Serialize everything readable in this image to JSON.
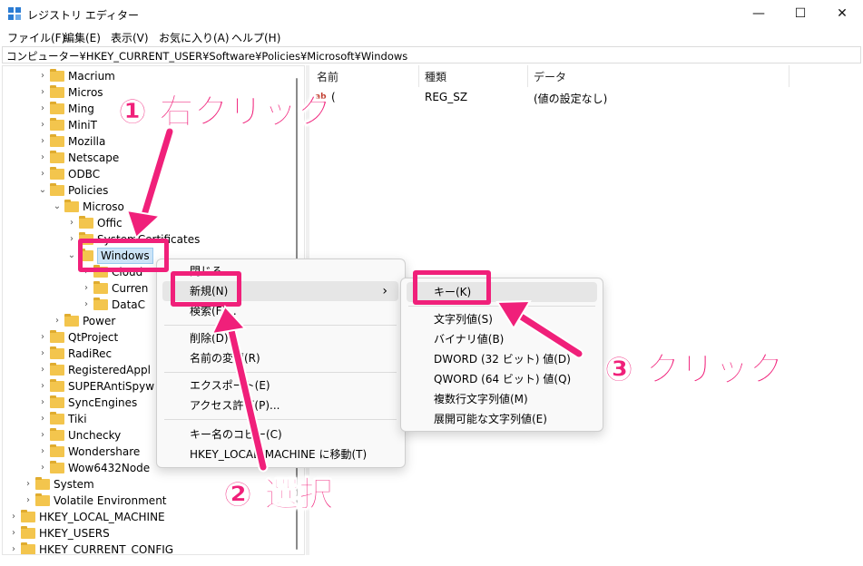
{
  "window": {
    "title": "レジストリ エディター",
    "minimize": "—",
    "maximize": "☐",
    "close": "✕"
  },
  "menu": [
    "ファイル(F)",
    "編集(E)",
    "表示(V)",
    "お気に入り(A)",
    "ヘルプ(H)"
  ],
  "address": "コンピューター¥HKEY_CURRENT_USER¥Software¥Policies¥Microsoft¥Windows",
  "tree": [
    {
      "label": "Macrium",
      "expanded": false
    },
    {
      "label": "Micros",
      "expanded": false
    },
    {
      "label": "Ming",
      "expanded": false
    },
    {
      "label": "MiniT",
      "expanded": false
    },
    {
      "label": "Mozilla",
      "expanded": false
    },
    {
      "label": "Netscape",
      "expanded": false
    },
    {
      "label": "ODBC",
      "expanded": false
    },
    {
      "label": "Policies",
      "expanded": true
    },
    {
      "label": "Microso",
      "expanded": true
    },
    {
      "label": "Offic",
      "expanded": false
    },
    {
      "label": "SystemCertificates",
      "expanded": false
    },
    {
      "label": "Windows",
      "expanded": true,
      "selected": true
    },
    {
      "label": "Cloud",
      "expanded": false
    },
    {
      "label": "Curren",
      "expanded": false
    },
    {
      "label": "DataC",
      "expanded": false
    },
    {
      "label": "Power",
      "expanded": false
    },
    {
      "label": "QtProject",
      "expanded": false
    },
    {
      "label": "RadiRec",
      "expanded": false
    },
    {
      "label": "RegisteredAppl",
      "expanded": false
    },
    {
      "label": "SUPERAntiSpyw",
      "expanded": false
    },
    {
      "label": "SyncEngines",
      "expanded": false
    },
    {
      "label": "Tiki",
      "expanded": false
    },
    {
      "label": "Unchecky",
      "expanded": false
    },
    {
      "label": "Wondershare",
      "expanded": false
    },
    {
      "label": "Wow6432Node",
      "expanded": false
    },
    {
      "label": "System",
      "expanded": false
    },
    {
      "label": "Volatile Environment",
      "expanded": false
    },
    {
      "label": "HKEY_LOCAL_MACHINE",
      "expanded": false
    },
    {
      "label": "HKEY_USERS",
      "expanded": false
    },
    {
      "label": "HKEY_CURRENT_CONFIG",
      "expanded": false
    }
  ],
  "list": {
    "columns": [
      "名前",
      "種類",
      "データ"
    ],
    "rows": [
      {
        "name": "(",
        "type": "REG_SZ",
        "data": "(値の設定なし)"
      }
    ]
  },
  "context_menu": {
    "items": [
      "閉じる",
      "新規(N)",
      "検索(F)...",
      "削除(D)",
      "名前の変更(R)",
      "エクスポート(E)",
      "アクセス許可(P)...",
      "キー名のコピー(C)",
      "HKEY_LOCAL_MACHINE に移動(T)"
    ],
    "submenu_arrow": "›"
  },
  "submenu": {
    "items": [
      "キー(K)",
      "文字列値(S)",
      "バイナリ値(B)",
      "DWORD (32 ビット) 値(D)",
      "QWORD (64 ビット) 値(Q)",
      "複数行文字列値(M)",
      "展開可能な文字列値(E)"
    ]
  },
  "annotations": {
    "step1": "① 右クリック",
    "step2": "② 選択",
    "step3": "③ クリック",
    "color": "#f0207a"
  }
}
